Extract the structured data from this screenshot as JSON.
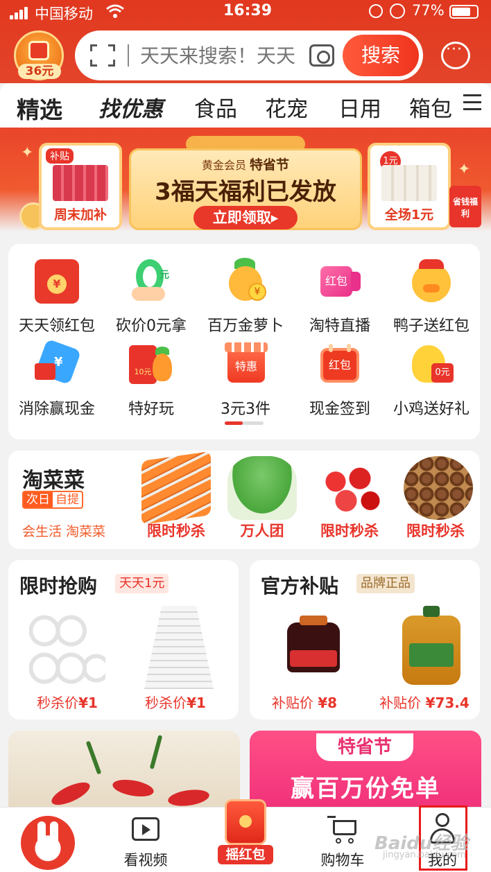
{
  "status_bar": {
    "carrier": "中国移动",
    "time": "16:39",
    "battery_percent": "77%",
    "battery_level": 0.77
  },
  "header": {
    "coupon_amount": "36元",
    "search": {
      "placeholder": "天天来搜索！天天",
      "button_label": "搜索"
    }
  },
  "category_tabs": [
    "精选",
    "找优惠",
    "食品",
    "花宠",
    "日用",
    "箱包"
  ],
  "banner": {
    "left_card": {
      "tag": "补贴",
      "caption": "周末加补"
    },
    "main": {
      "vip_label": "黄金会员",
      "festival": "特省节",
      "title": "3福天福利已发放",
      "cta": "立即领取▸"
    },
    "right_card": {
      "tag": "1元",
      "caption": "全场1元"
    },
    "corner_flag": "省钱福利"
  },
  "quick_entries": [
    {
      "label": "天天领红包",
      "icon": "red-packet-icon"
    },
    {
      "label": "砍价0元拿",
      "icon": "bargain-zero-icon"
    },
    {
      "label": "百万金萝卜",
      "icon": "gold-carrot-icon"
    },
    {
      "label": "淘特直播",
      "icon": "live-stream-icon",
      "icon_text": "红包"
    },
    {
      "label": "鸭子送红包",
      "icon": "duck-icon"
    },
    {
      "label": "消除赢现金",
      "icon": "star-cash-icon"
    },
    {
      "label": "特好玩",
      "icon": "fun-game-icon",
      "icon_text": "10元"
    },
    {
      "label": "3元3件",
      "icon": "sale-shop-icon",
      "icon_text": "特惠"
    },
    {
      "label": "现金签到",
      "icon": "calendar-icon",
      "icon_text": "红包"
    },
    {
      "label": "小鸡送好礼",
      "icon": "chick-gift-icon",
      "icon_text": "0元"
    }
  ],
  "taocaicai": {
    "title": "淘菜菜",
    "badge_a": "次日",
    "badge_b": "自提",
    "subtitle": "会生活 淘菜菜",
    "items": [
      {
        "caption": "限时秒杀",
        "product": "carrots"
      },
      {
        "caption": "万人团",
        "product": "greens"
      },
      {
        "caption": "限时秒杀",
        "product": "tomatoes"
      },
      {
        "caption": "限时秒杀",
        "product": "chestnuts"
      }
    ]
  },
  "flash_sale": {
    "title": "限时抢购",
    "tag": "天天1元",
    "items": [
      {
        "price_label": "秒杀价",
        "price": "¥1"
      },
      {
        "price_label": "秒杀价",
        "price": "¥1"
      }
    ]
  },
  "subsidy": {
    "title": "官方补贴",
    "tag": "品牌正品",
    "items": [
      {
        "price_label": "补贴价",
        "price": "¥8"
      },
      {
        "price_label": "补贴价",
        "price": "¥73.4"
      }
    ]
  },
  "promo_right": {
    "title": "特省节",
    "headline": "赢百万份免单"
  },
  "tab_bar": {
    "items": [
      {
        "label": "",
        "icon": "home-rabbit-icon"
      },
      {
        "label": "看视频",
        "icon": "video-icon"
      },
      {
        "label": "摇红包",
        "icon": "shake-red-packet-icon"
      },
      {
        "label": "购物车",
        "icon": "cart-icon"
      },
      {
        "label": "我的",
        "icon": "user-icon"
      }
    ]
  },
  "watermark": {
    "brand": "Baidu经验",
    "url": "jingyan.baidu.com"
  },
  "colors": {
    "brand_red": "#e1381f",
    "price_red": "#e8342a",
    "highlight_box": "#e81a1a"
  }
}
